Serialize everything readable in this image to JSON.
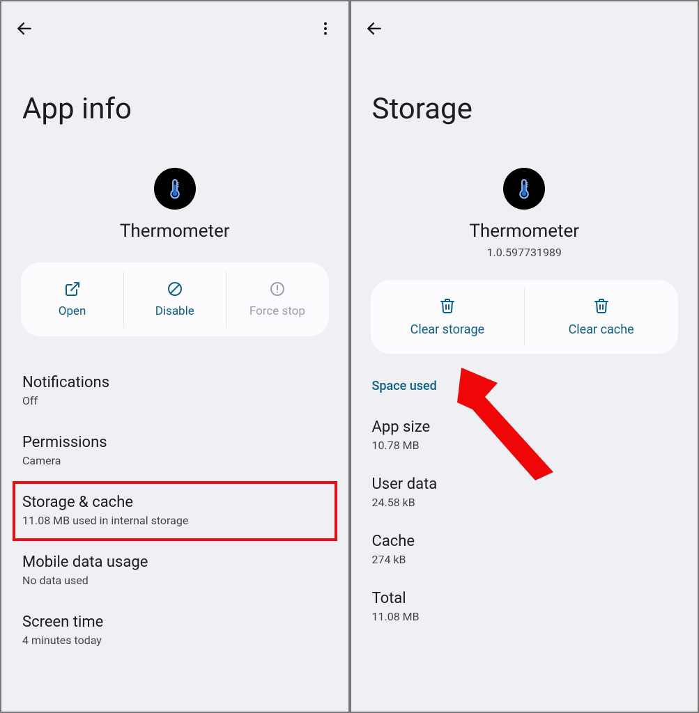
{
  "left": {
    "title": "App info",
    "app_name": "Thermometer",
    "actions": {
      "open": "Open",
      "disable": "Disable",
      "force_stop": "Force stop"
    },
    "items": [
      {
        "title": "Notifications",
        "sub": "Off"
      },
      {
        "title": "Permissions",
        "sub": "Camera"
      },
      {
        "title": "Storage & cache",
        "sub": "11.08 MB used in internal storage"
      },
      {
        "title": "Mobile data usage",
        "sub": "No data used"
      },
      {
        "title": "Screen time",
        "sub": "4 minutes today"
      }
    ]
  },
  "right": {
    "title": "Storage",
    "app_name": "Thermometer",
    "version": "1.0.597731989",
    "actions": {
      "clear_storage": "Clear storage",
      "clear_cache": "Clear cache"
    },
    "section": "Space used",
    "stats": [
      {
        "title": "App size",
        "value": "10.78 MB"
      },
      {
        "title": "User data",
        "value": "24.58 kB"
      },
      {
        "title": "Cache",
        "value": "274 kB"
      },
      {
        "title": "Total",
        "value": "11.08 MB"
      }
    ]
  }
}
